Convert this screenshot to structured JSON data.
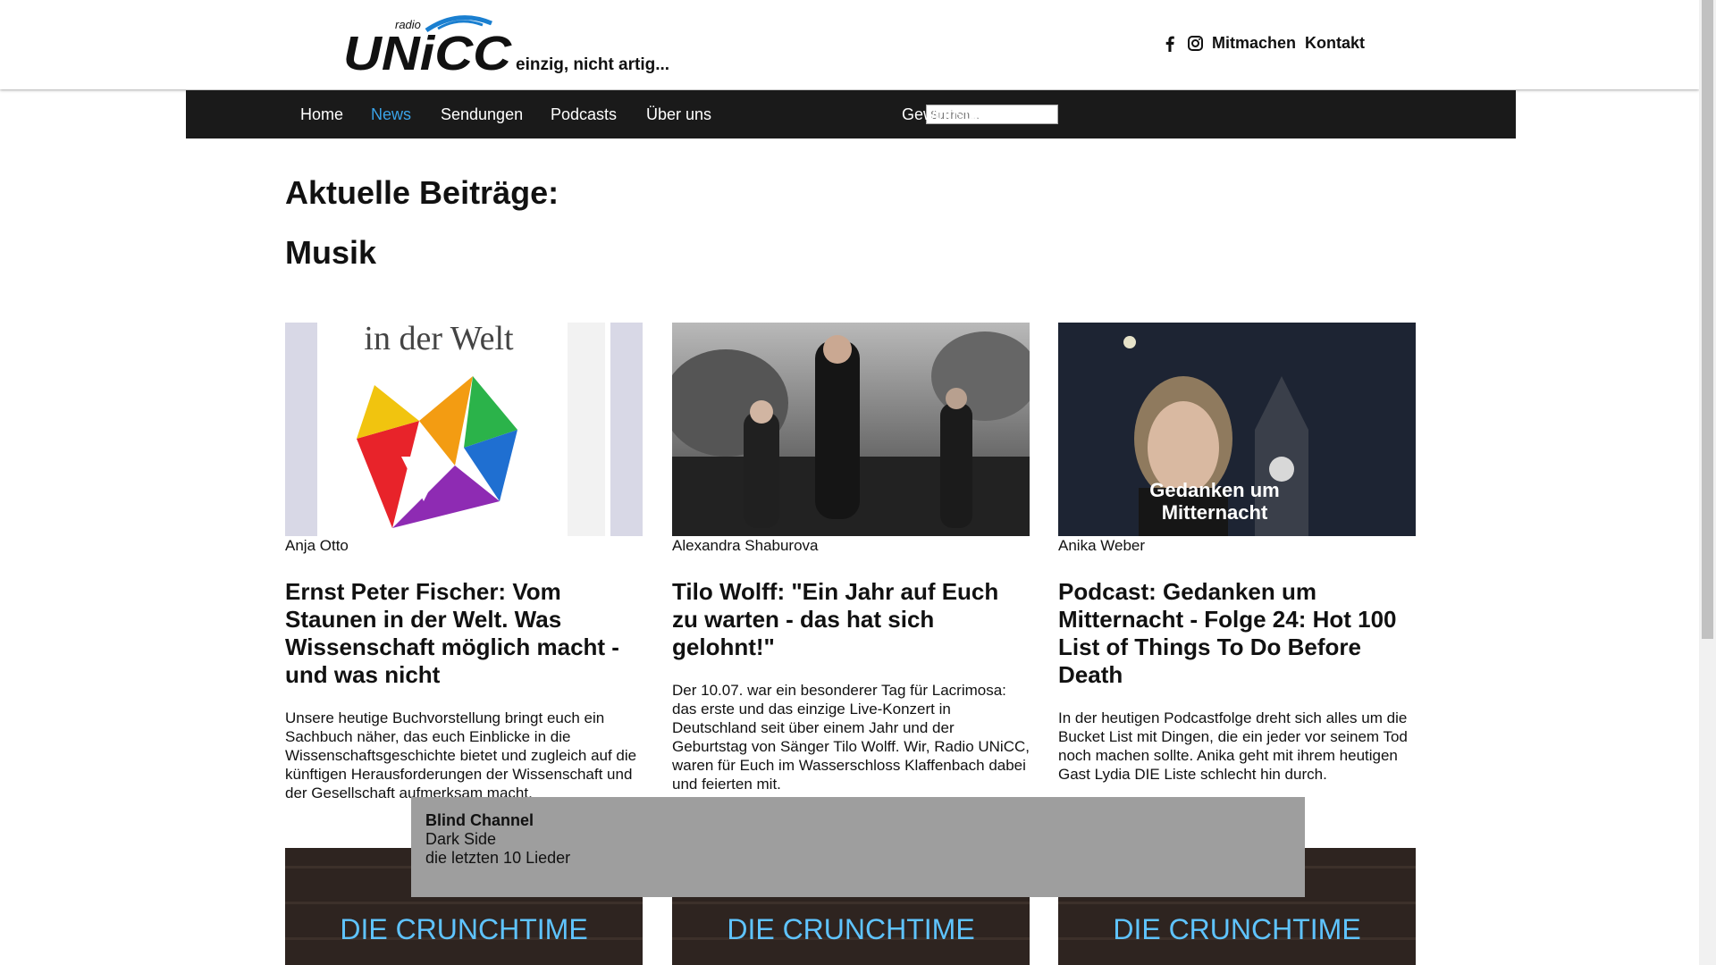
{
  "header": {
    "logo_text": "radio UNiCC",
    "slogan": "einzig, nicht artig...",
    "links": [
      "Mitmachen",
      "Kontakt"
    ],
    "social_icons": [
      "facebook-icon",
      "instagram-icon"
    ]
  },
  "nav": {
    "items": [
      "Home",
      "News",
      "Sendungen",
      "Podcasts",
      "Über uns"
    ],
    "active": "News",
    "search_placeholder": "Suchen...",
    "extra": "Gewinnspiele"
  },
  "main": {
    "page_title": "Aktuelle Beiträge:",
    "section_title": "Musik"
  },
  "articles": [
    {
      "image_caption": "in der Welt",
      "author": "Anja Otto",
      "title": "Ernst Peter Fischer: Vom Staunen in der Welt. Was Wissenschaft möglich macht - und was nicht",
      "excerpt": "Unsere heutige Buchvorstellung bringt euch ein Sachbuch näher, das euch Einblicke in die Wissenschaftsgeschichte bietet und zugleich auf die künftigen Herausforderungen der Wissenschaft und der Gesellschaft aufmerksam macht."
    },
    {
      "author": "Alexandra Shaburova",
      "title": "Tilo Wolff: \"Ein Jahr auf Euch zu warten - das hat sich gelohnt!\"",
      "excerpt": "Der 10.07. war ein besonderer Tag für Lacrimosa: das erste und das einzige Live-Konzert in Deutschland seit über einem Jahr und der Geburtstag von Sänger Tilo Wolff. Wir, Radio UNiCC, waren für Euch im Wasserschloss Klaffenbach dabei und feierten mit."
    },
    {
      "image_caption_1": "Gedanken um",
      "image_caption_2": "Mitternacht",
      "author": "Anika Weber",
      "title": "Podcast: Gedanken um Mitternacht - Folge 24: Hot 100 List of Things To Do Before Death",
      "excerpt": "In der heutigen Podcastfolge dreht sich alles um die Bucket List mit Dingen, die ein jeder vor seinem Tod noch machen sollte. Anika geht mit ihrem heutigen Gast Lydia DIE Liste schlecht hin durch."
    }
  ],
  "second_row": {
    "image_text": "DIE CRUNCHTIME"
  },
  "now_playing": {
    "artist": "Blind Channel",
    "track": "Dark Side",
    "link": "die letzten 10 Lieder"
  }
}
